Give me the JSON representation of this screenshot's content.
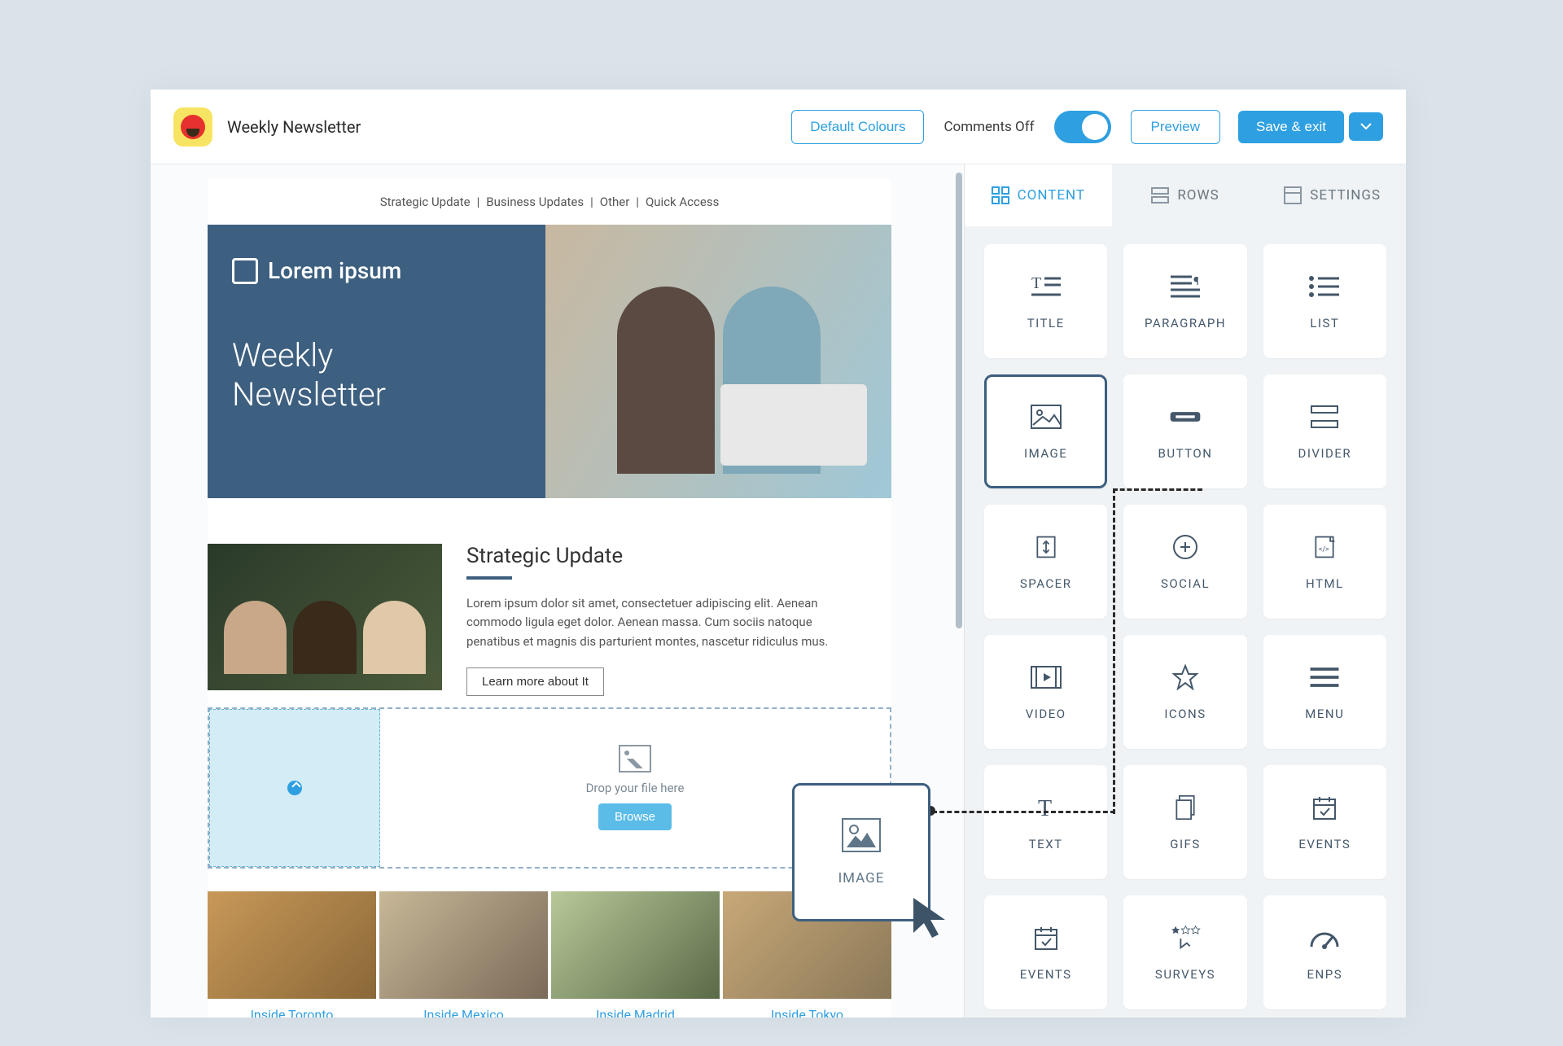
{
  "header": {
    "doc_title": "Weekly Newsletter",
    "default_colours": "Default Colours",
    "comments_label": "Comments Off",
    "preview": "Preview",
    "save_exit": "Save & exit"
  },
  "email": {
    "nav": [
      "Strategic Update",
      "Business Updates",
      "Other",
      "Quick Access"
    ],
    "hero_logo": "Lorem ipsum",
    "hero_title": "Weekly\nNewsletter",
    "strategic_title": "Strategic Update",
    "strategic_body": "Lorem ipsum dolor sit amet, consectetuer adipiscing elit. Aenean commodo ligula eget dolor. Aenean massa. Cum sociis natoque penatibus et magnis dis parturient montes, nascetur ridiculus mus.",
    "learn_more": "Learn more about It",
    "drop_label": "Drop your file here",
    "browse": "Browse",
    "drag_block_label": "IMAGE",
    "gallery_links": [
      "Inside Toronto",
      "Inside Mexico",
      "Inside Madrid",
      "Inside Tokyo"
    ]
  },
  "panel": {
    "tabs": {
      "content": "CONTENT",
      "rows": "ROWS",
      "settings": "SETTINGS"
    },
    "blocks": [
      {
        "id": "title",
        "label": "TITLE"
      },
      {
        "id": "paragraph",
        "label": "PARAGRAPH"
      },
      {
        "id": "list",
        "label": "LIST"
      },
      {
        "id": "image",
        "label": "IMAGE",
        "selected": true
      },
      {
        "id": "button",
        "label": "BUTTON"
      },
      {
        "id": "divider",
        "label": "DIVIDER"
      },
      {
        "id": "spacer",
        "label": "SPACER"
      },
      {
        "id": "social",
        "label": "SOCIAL"
      },
      {
        "id": "html",
        "label": "HTML"
      },
      {
        "id": "video",
        "label": "VIDEO"
      },
      {
        "id": "icons",
        "label": "ICONS"
      },
      {
        "id": "menu",
        "label": "MENU"
      },
      {
        "id": "text",
        "label": "TEXT"
      },
      {
        "id": "gifs",
        "label": "GIFS"
      },
      {
        "id": "events",
        "label": "EVENTS"
      },
      {
        "id": "events2",
        "label": "EVENTS"
      },
      {
        "id": "surveys",
        "label": "SURVEYS"
      },
      {
        "id": "enps",
        "label": "ENPS"
      }
    ]
  }
}
